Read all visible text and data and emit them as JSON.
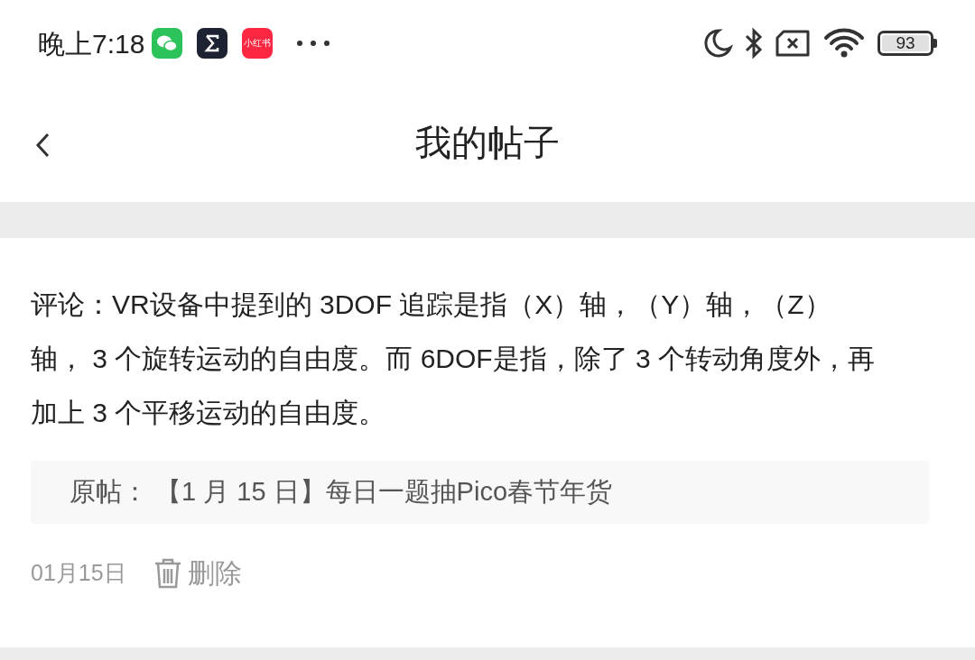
{
  "status_bar": {
    "time": "晚上7:18",
    "app_badge": "小红书",
    "battery": "93"
  },
  "header": {
    "title": "我的帖子"
  },
  "posts": [
    {
      "comment": "评论：VR设备中提到的 3DOF 追踪是指（X）轴，（Y）轴，（Z）轴， 3 个旋转运动的自由度。而 6DOF是指，除了 3 个转动角度外，再加上 3 个平移运动的自由度。",
      "original": "原帖： 【1 月 15 日】每日一题抽Pico春节年货",
      "date": "01月15日",
      "delete_label": "删除"
    }
  ]
}
